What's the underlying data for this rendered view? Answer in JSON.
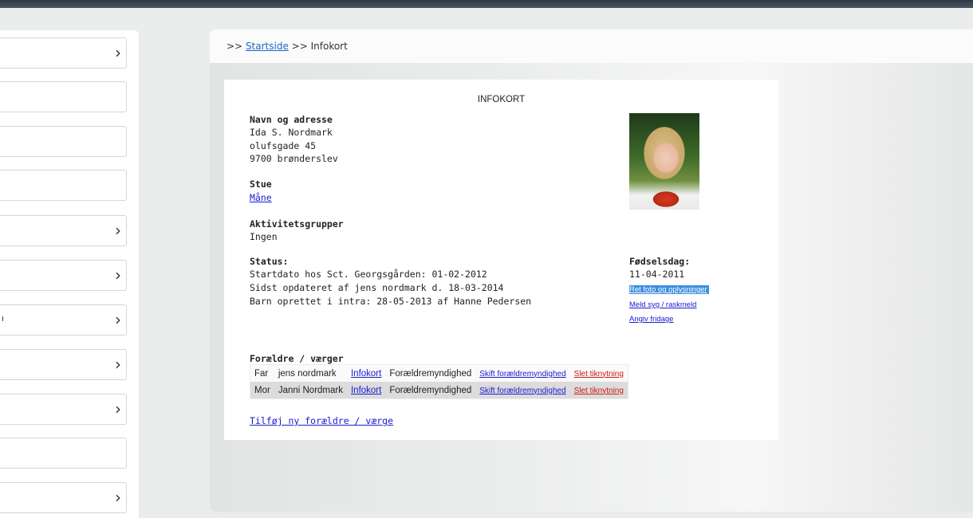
{
  "sidebar": {
    "items": [
      {
        "label": "",
        "chevron": true
      },
      {
        "label": "",
        "chevron": false
      },
      {
        "label": "",
        "chevron": false
      },
      {
        "label": "",
        "chevron": false
      },
      {
        "label": "",
        "chevron": true
      },
      {
        "label": "",
        "chevron": true
      },
      {
        "label": "ı",
        "chevron": true
      },
      {
        "label": "",
        "chevron": true
      },
      {
        "label": "",
        "chevron": true
      },
      {
        "label": "",
        "chevron": false
      },
      {
        "label": "",
        "chevron": true
      }
    ],
    "chevron_glyph": "›"
  },
  "breadcrumb": {
    "sep1": ">>",
    "home_link": "Startside",
    "sep2": ">>",
    "current": "Infokort"
  },
  "card": {
    "title": "INFOKORT",
    "name_heading": "Navn og adresse",
    "name": "Ida S. Nordmark",
    "street": "olufsgade 45",
    "city": "9700 brønderslev",
    "room_heading": "Stue",
    "room_link": "Måne",
    "groups_heading": "Aktivitetsgrupper",
    "groups_value": "Ingen",
    "status_heading": "Status:",
    "status_lines": [
      "Startdato hos Sct. Georgsgården: 01-02-2012",
      "Sidst opdateret af jens nordmark d. 18-03-2014",
      "Barn oprettet i intra: 28-05-2013 af Hanne Pedersen"
    ],
    "birthday_heading": "Fødselsdag:",
    "birthday_value": "11-04-2011",
    "action_links": [
      "Ret foto og oplysninger",
      "Meld syg / raskmeld",
      "Angiv fridage"
    ],
    "parents_heading": "Forældre / værger",
    "parents": [
      {
        "role": "Far",
        "name": "jens nordmark",
        "info": "Infokort",
        "custody": "Forældremyndighed",
        "change": "Skift forældremyndighed",
        "delete": "Slet tiknytning"
      },
      {
        "role": "Mor",
        "name": "Janni Nordmark",
        "info": "Infokort",
        "custody": "Forældremyndighed",
        "change": "Skift forældremyndighed",
        "delete": "Slet tiknytning"
      }
    ],
    "add_parent_link": "Tilføj ny forældre / værge"
  },
  "colors": {
    "link": "#1a1ad0",
    "breadcrumb_link": "#1e67c8",
    "delete_link": "#d01818",
    "selection": "#3c8de0"
  }
}
